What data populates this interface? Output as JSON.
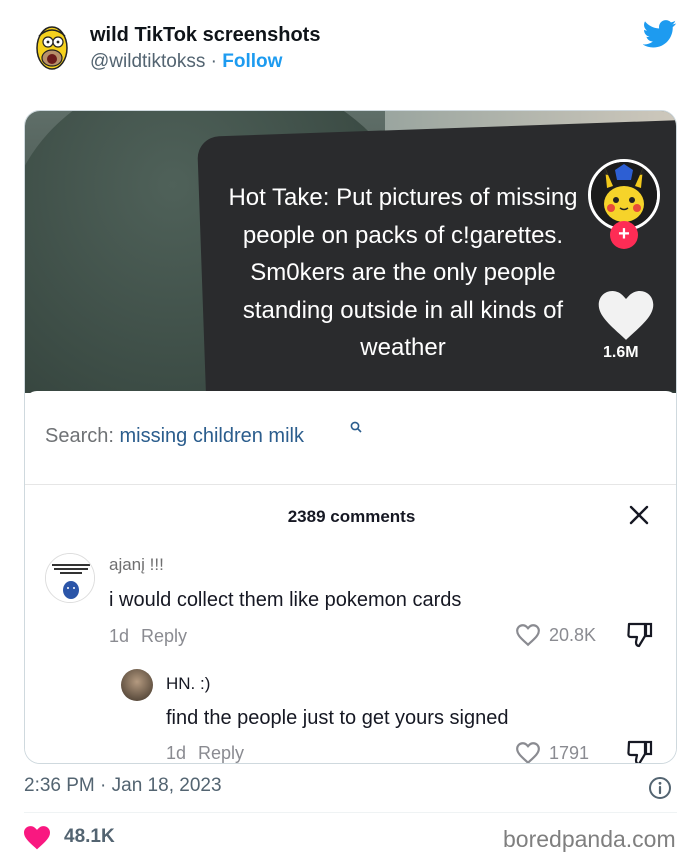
{
  "tweet": {
    "author_name": "wild TikTok screenshots",
    "handle": "@wildtiktokss",
    "separator": " · ",
    "follow_label": "Follow",
    "timestamp": "2:36 PM · Jan 18, 2023",
    "likes": "48.1K"
  },
  "tiktok": {
    "hot_take": "Hot Take: Put pictures of missing people on packs of c!garettes. Sm0kers are the only people standing outside in all kinds of weather",
    "likes": "1.6M",
    "follow_plus": "+",
    "search_prefix": "Search: ",
    "search_term": "missing children milk",
    "comments_count": "2389 comments",
    "comments": [
      {
        "username": "ajanį !!!",
        "text": "i would collect them like pokemon cards",
        "age": "1d",
        "reply_label": "Reply",
        "likes": "20.8K"
      }
    ],
    "replies": [
      {
        "username": "HN. :)",
        "text": "find the people just to get yours signed",
        "age": "1d",
        "reply_label": "Reply",
        "likes": "1791"
      }
    ]
  },
  "watermark": "boredpanda.com",
  "colors": {
    "twitter_blue": "#1d9bf0",
    "like_pink": "#f91880",
    "tiktok_red": "#fe2c55",
    "muted_text": "#536471"
  }
}
